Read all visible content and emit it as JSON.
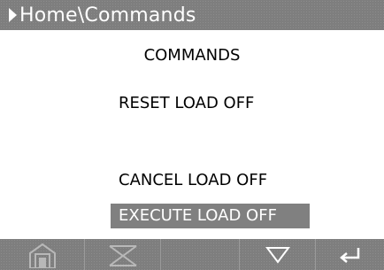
{
  "header": {
    "breadcrumb": "Home\\Commands"
  },
  "main": {
    "heading": "COMMANDS",
    "commands": [
      {
        "label": "RESET LOAD OFF"
      },
      {
        "label": "CANCEL LOAD OFF"
      },
      {
        "label": "EXECUTE LOAD OFF",
        "selected": true
      }
    ]
  },
  "softkeys": [
    {
      "icon": "home-icon"
    },
    {
      "icon": "scroll-up-down-icon"
    },
    {
      "icon": "blank"
    },
    {
      "icon": "down-arrow-icon"
    },
    {
      "icon": "enter-icon"
    }
  ]
}
